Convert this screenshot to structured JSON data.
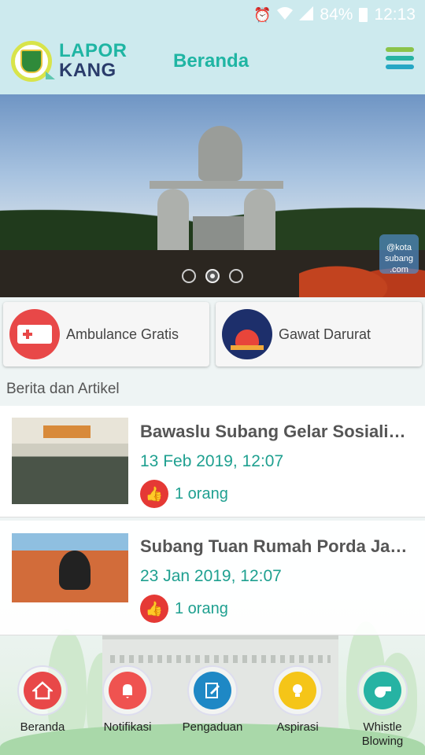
{
  "status_bar": {
    "battery": "84%",
    "time": "12:13",
    "icons": [
      "alarm-icon",
      "wifi-icon",
      "signal-icon",
      "battery-icon"
    ]
  },
  "app_bar": {
    "brand_line1": "LAPOR",
    "brand_line2": "KANG",
    "title": "Beranda",
    "menu_icon": "hamburger-menu-icon",
    "colors": {
      "teal": "#1fb5a3",
      "navy": "#2a3c6b",
      "bar_bg": "#cdeaee"
    }
  },
  "banner": {
    "watermark_line1": "@kota",
    "watermark_line2": "subang",
    "watermark_line3": ".com",
    "slides": 3,
    "active_slide": 2
  },
  "quick_actions": [
    {
      "label": "Ambulance Gratis",
      "icon": "ambulance-icon",
      "color": "#e84848"
    },
    {
      "label": "Gawat Darurat",
      "icon": "siren-icon",
      "color": "#1d2f6b"
    }
  ],
  "section": {
    "title": "Berita dan Artikel"
  },
  "news": [
    {
      "title": "Bawaslu Subang Gelar Sosialisasi",
      "date": "13 Feb 2019, 12:07",
      "likes": "1 orang"
    },
    {
      "title": "Subang Tuan Rumah Porda Jawa Barat",
      "date": "23 Jan 2019, 12:07",
      "likes": "1 orang"
    }
  ],
  "bottom_nav": [
    {
      "label": "Beranda",
      "icon": "home-icon",
      "color": "#e84848"
    },
    {
      "label": "Notifikasi",
      "icon": "bell-icon",
      "color": "#ef5350"
    },
    {
      "label": "Pengaduan",
      "icon": "edit-document-icon",
      "color": "#1e88c5"
    },
    {
      "label": "Aspirasi",
      "icon": "lightbulb-icon",
      "color": "#f5c518"
    },
    {
      "label": "Whistle\nBlowing",
      "icon": "whistle-icon",
      "color": "#26b3a3"
    }
  ]
}
